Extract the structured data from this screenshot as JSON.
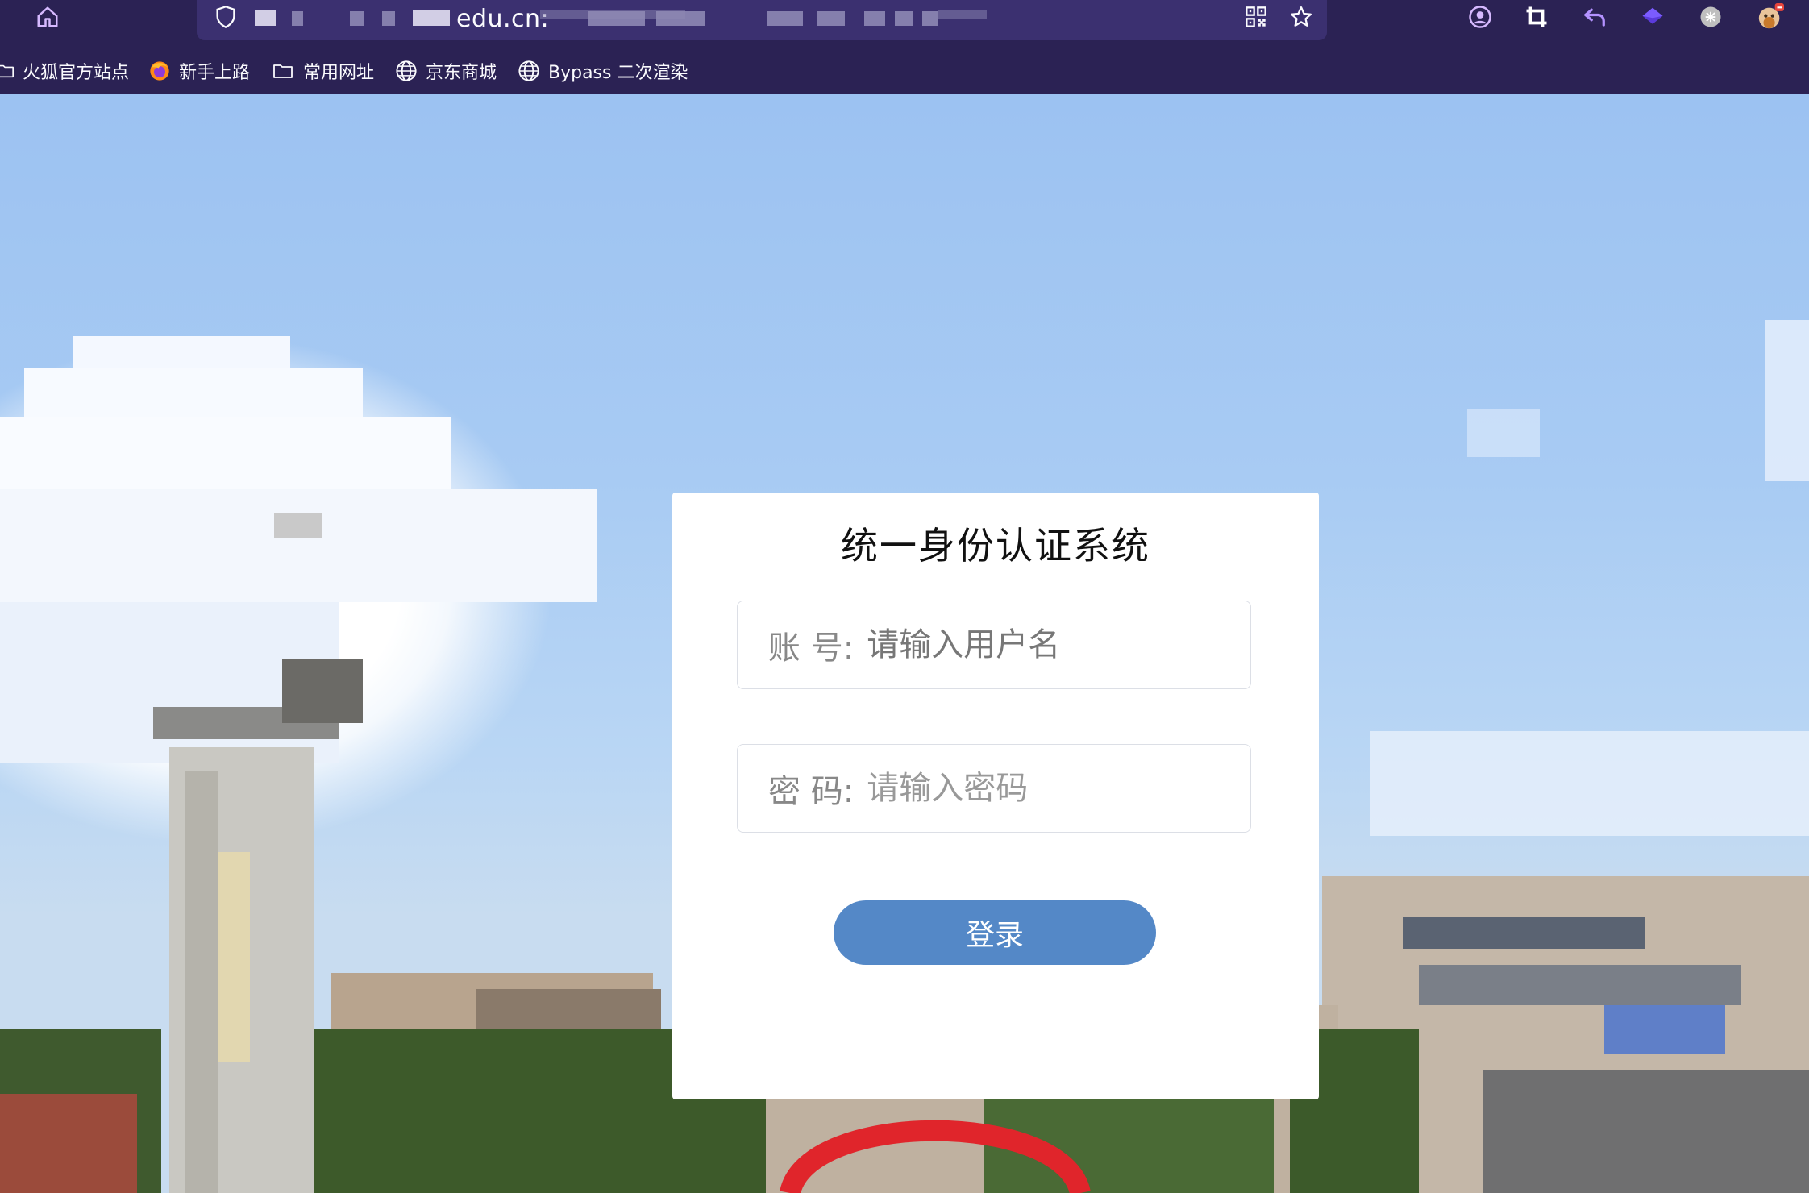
{
  "browser": {
    "url_visible": "edu.cn:",
    "bookmarks": [
      {
        "label": "火狐官方站点",
        "icon": "folder-icon"
      },
      {
        "label": "新手上路",
        "icon": "firefox-icon"
      },
      {
        "label": "常用网址",
        "icon": "folder-icon"
      },
      {
        "label": "京东商城",
        "icon": "globe-icon"
      },
      {
        "label": "Bypass 二次渲染",
        "icon": "globe-icon"
      }
    ]
  },
  "login": {
    "title": "统一身份认证系统",
    "username_label": "账  号:",
    "username_placeholder": "请输入用户名",
    "password_label": "密  码:",
    "password_placeholder": "请输入密码",
    "submit_label": "登录"
  },
  "colors": {
    "chrome_bg": "#2b2254",
    "urlbar_bg": "#3b3070",
    "button_bg": "#5488c7",
    "card_bg": "#ffffff"
  }
}
